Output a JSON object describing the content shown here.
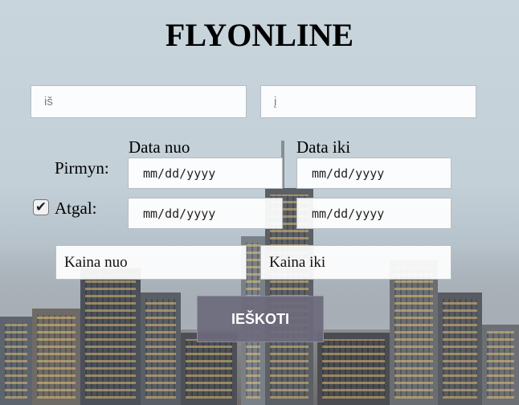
{
  "app": {
    "title": "FLYONLINE"
  },
  "search": {
    "from_placeholder": "iš",
    "to_placeholder": "į"
  },
  "dates": {
    "from_label": "Data nuo",
    "to_label": "Data iki",
    "outbound_label": "Pirmyn:",
    "return_label": "Atgal:",
    "date_format": "mm/dd/yyyy",
    "return_checked_glyph": "✔"
  },
  "price": {
    "min_label": "Kaina nuo",
    "max_label": "Kaina iki"
  },
  "actions": {
    "search_label": "IEŠKOTI"
  },
  "colors": {
    "button_bg": "#6c6a7c",
    "field_bg": "#ffffff"
  }
}
